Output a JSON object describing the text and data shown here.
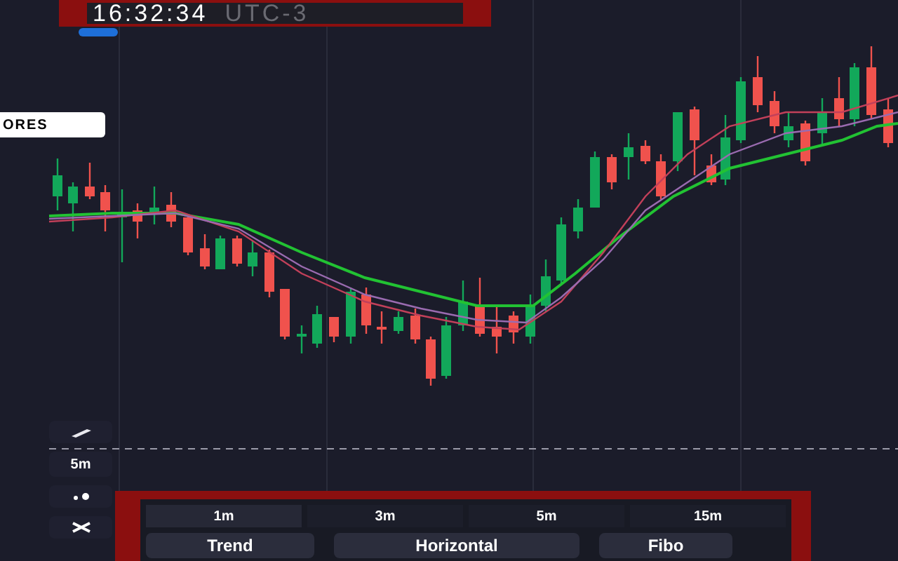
{
  "clock": {
    "time": "16:32:34",
    "timezone": "UTC-3"
  },
  "side_label": "ORES",
  "left_toolbar": {
    "interval": "5m"
  },
  "intervals": [
    {
      "label": "1m",
      "selected": true
    },
    {
      "label": "3m",
      "selected": false
    },
    {
      "label": "5m",
      "selected": false
    },
    {
      "label": "15m",
      "selected": false
    }
  ],
  "drawing_tools": [
    {
      "label": "Trend"
    },
    {
      "label": "Horizontal"
    },
    {
      "label": "Fibo"
    }
  ]
}
